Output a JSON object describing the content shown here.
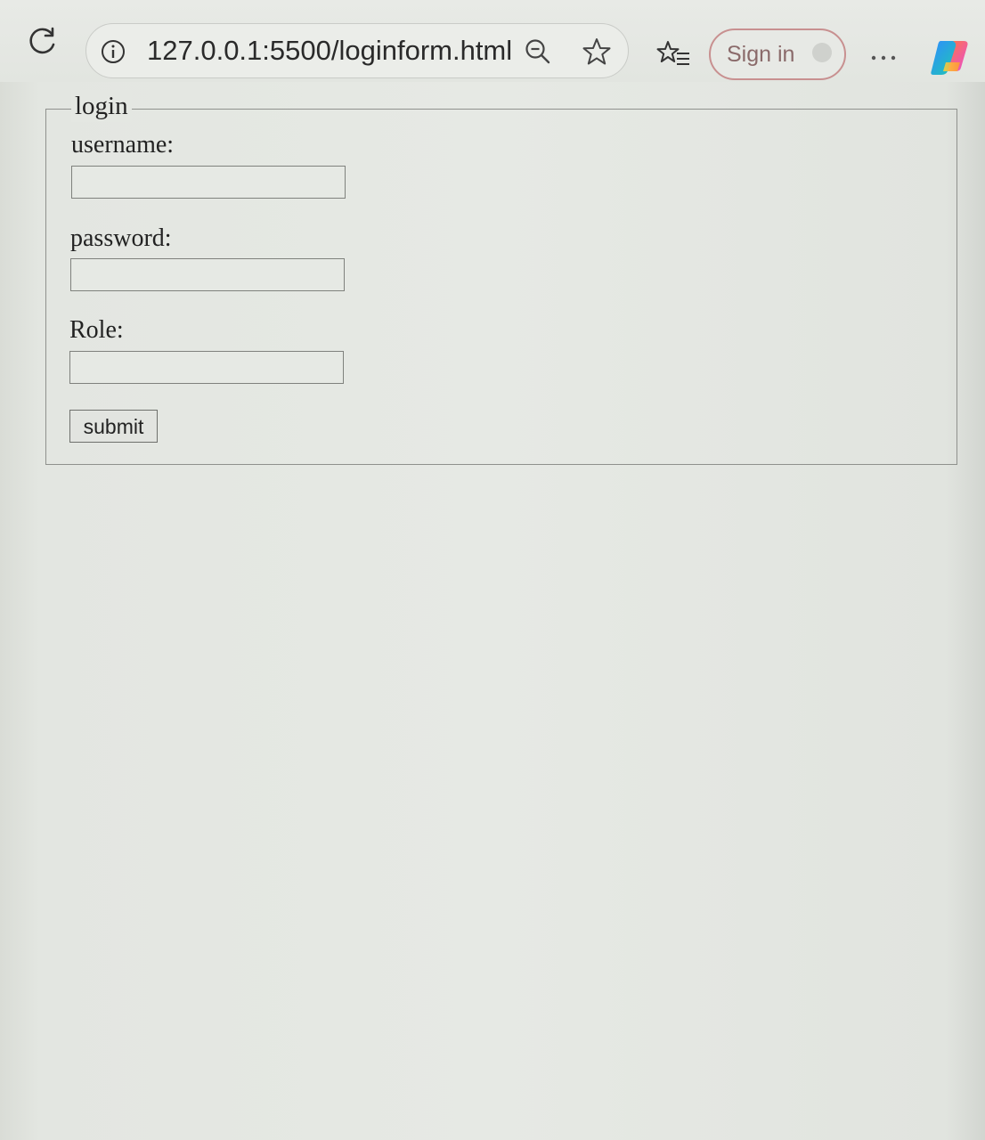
{
  "browser": {
    "url": "127.0.0.1:5500/loginform.html",
    "sign_in_label": "Sign in",
    "icons": [
      "reload-icon",
      "info-icon",
      "zoom-out-icon",
      "favorite-star-icon",
      "favorites-list-icon",
      "more-options-icon",
      "copilot-icon"
    ]
  },
  "form": {
    "legend": "login",
    "username_label": "username:",
    "username_value": "",
    "password_label": "password:",
    "password_value": "",
    "role_label": "Role:",
    "role_value": "",
    "submit_label": "submit"
  }
}
